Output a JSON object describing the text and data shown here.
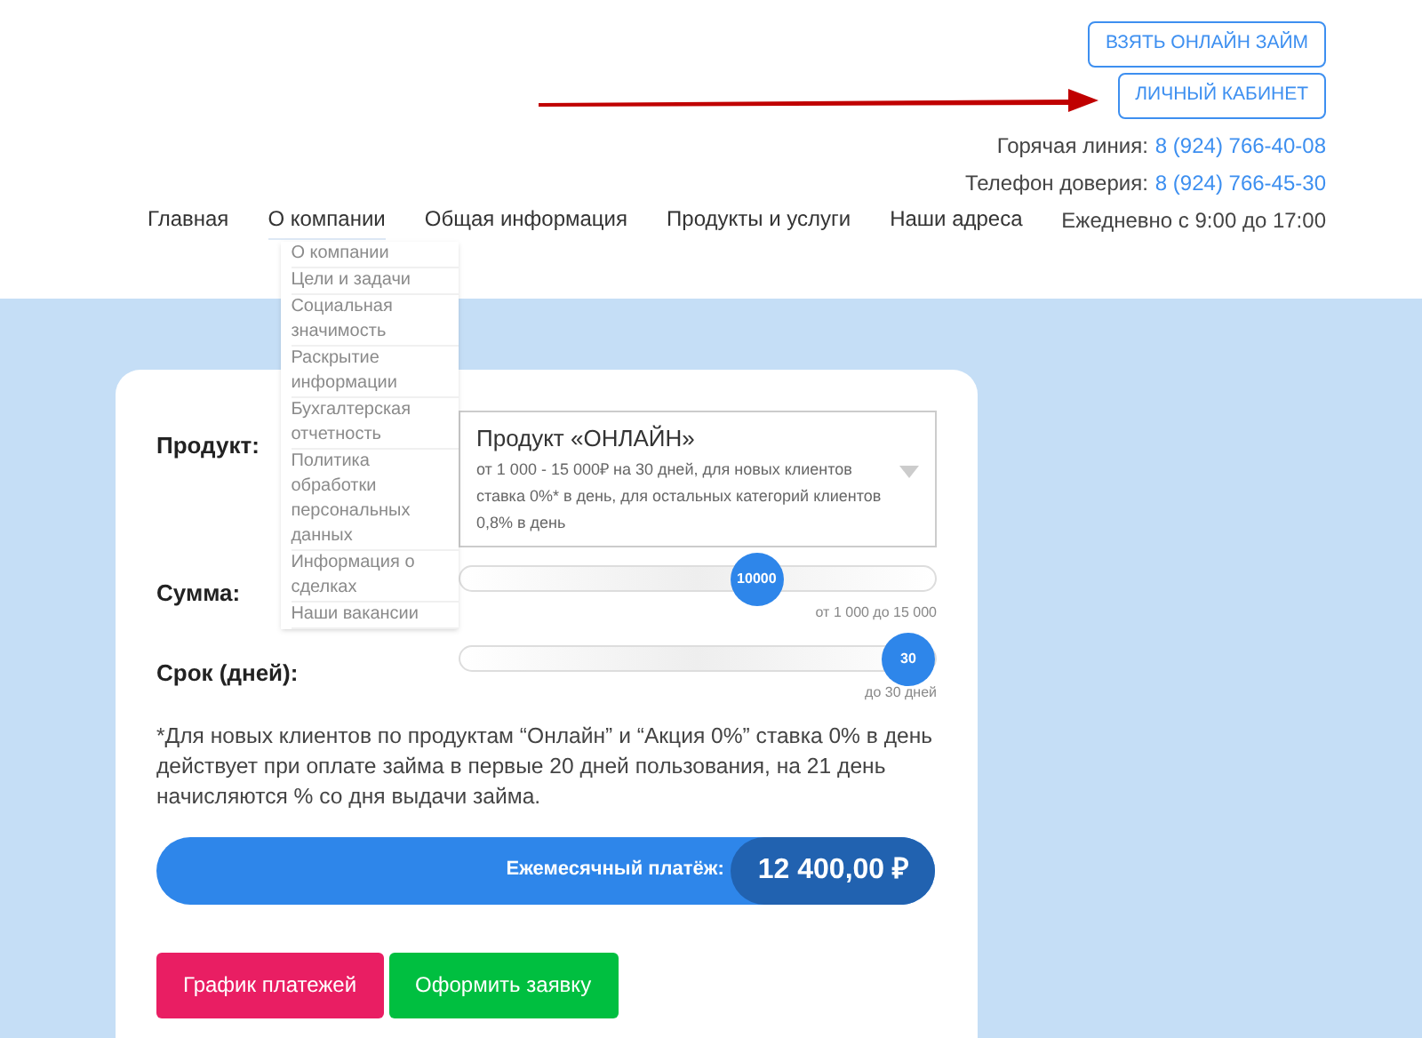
{
  "header_buttons": [
    "ВЗЯТЬ ОНЛАЙН ЗАЙМ",
    "ЛИЧНЫЙ КАБИНЕТ"
  ],
  "contacts": [
    {
      "label": "Горячая линия:",
      "phone": "8 (924) 766-40-08"
    },
    {
      "label": "Телефон доверия:",
      "phone": "8 (924) 766-45-30"
    }
  ],
  "hours": "Ежедневно с 9:00 до 17:00",
  "nav": [
    {
      "label": "Главная",
      "expanded": false
    },
    {
      "label": "О компании",
      "expanded": true,
      "children": [
        {
          "label": "О компании"
        },
        {
          "label": "Цели и задачи"
        },
        {
          "label": "Социальная значимость"
        },
        {
          "label": "Раскрытие информации"
        },
        {
          "label": "Бухгалтерская отчетность"
        },
        {
          "label": "Политика обработки персональных данных"
        },
        {
          "label": "Информация о сделках"
        },
        {
          "label": "Наши вакансии"
        }
      ]
    },
    {
      "label": "Общая информация",
      "expanded": false
    },
    {
      "label": "Продукты и услуги",
      "expanded": false
    },
    {
      "label": "Наши адреса",
      "expanded": false
    }
  ],
  "calculator": {
    "product": {
      "label": "Продукт:",
      "title": "Продукт «ОНЛАЙН»",
      "lines": [
        "от 1 000 - 15 000₽ на 30 дней, для новых клиентов",
        "ставка 0%* в день, для остальных категорий клиентов",
        "0,8% в день"
      ]
    },
    "sliders": [
      {
        "label": "Сумма:",
        "value": "10000",
        "level": 0.64,
        "hint": "от 1 000 до 15 000"
      },
      {
        "label": "Срок (дней):",
        "value": "30",
        "level": 1,
        "hint": "до 30 дней"
      }
    ],
    "note": "*Для новых клиентов по продуктам “Онлайн” и “Акция 0%” ставка 0% в день действует при оплате займа в первые 20 дней пользования, на 21 день начисляются % со дня выдачи займа.",
    "payment": {
      "label": "Ежемесячный платёж:",
      "value": "12 400,00 ₽"
    },
    "buttons": [
      {
        "label": "График платежей",
        "kind": "schedule"
      },
      {
        "label": "Оформить заявку",
        "kind": "apply"
      }
    ]
  }
}
